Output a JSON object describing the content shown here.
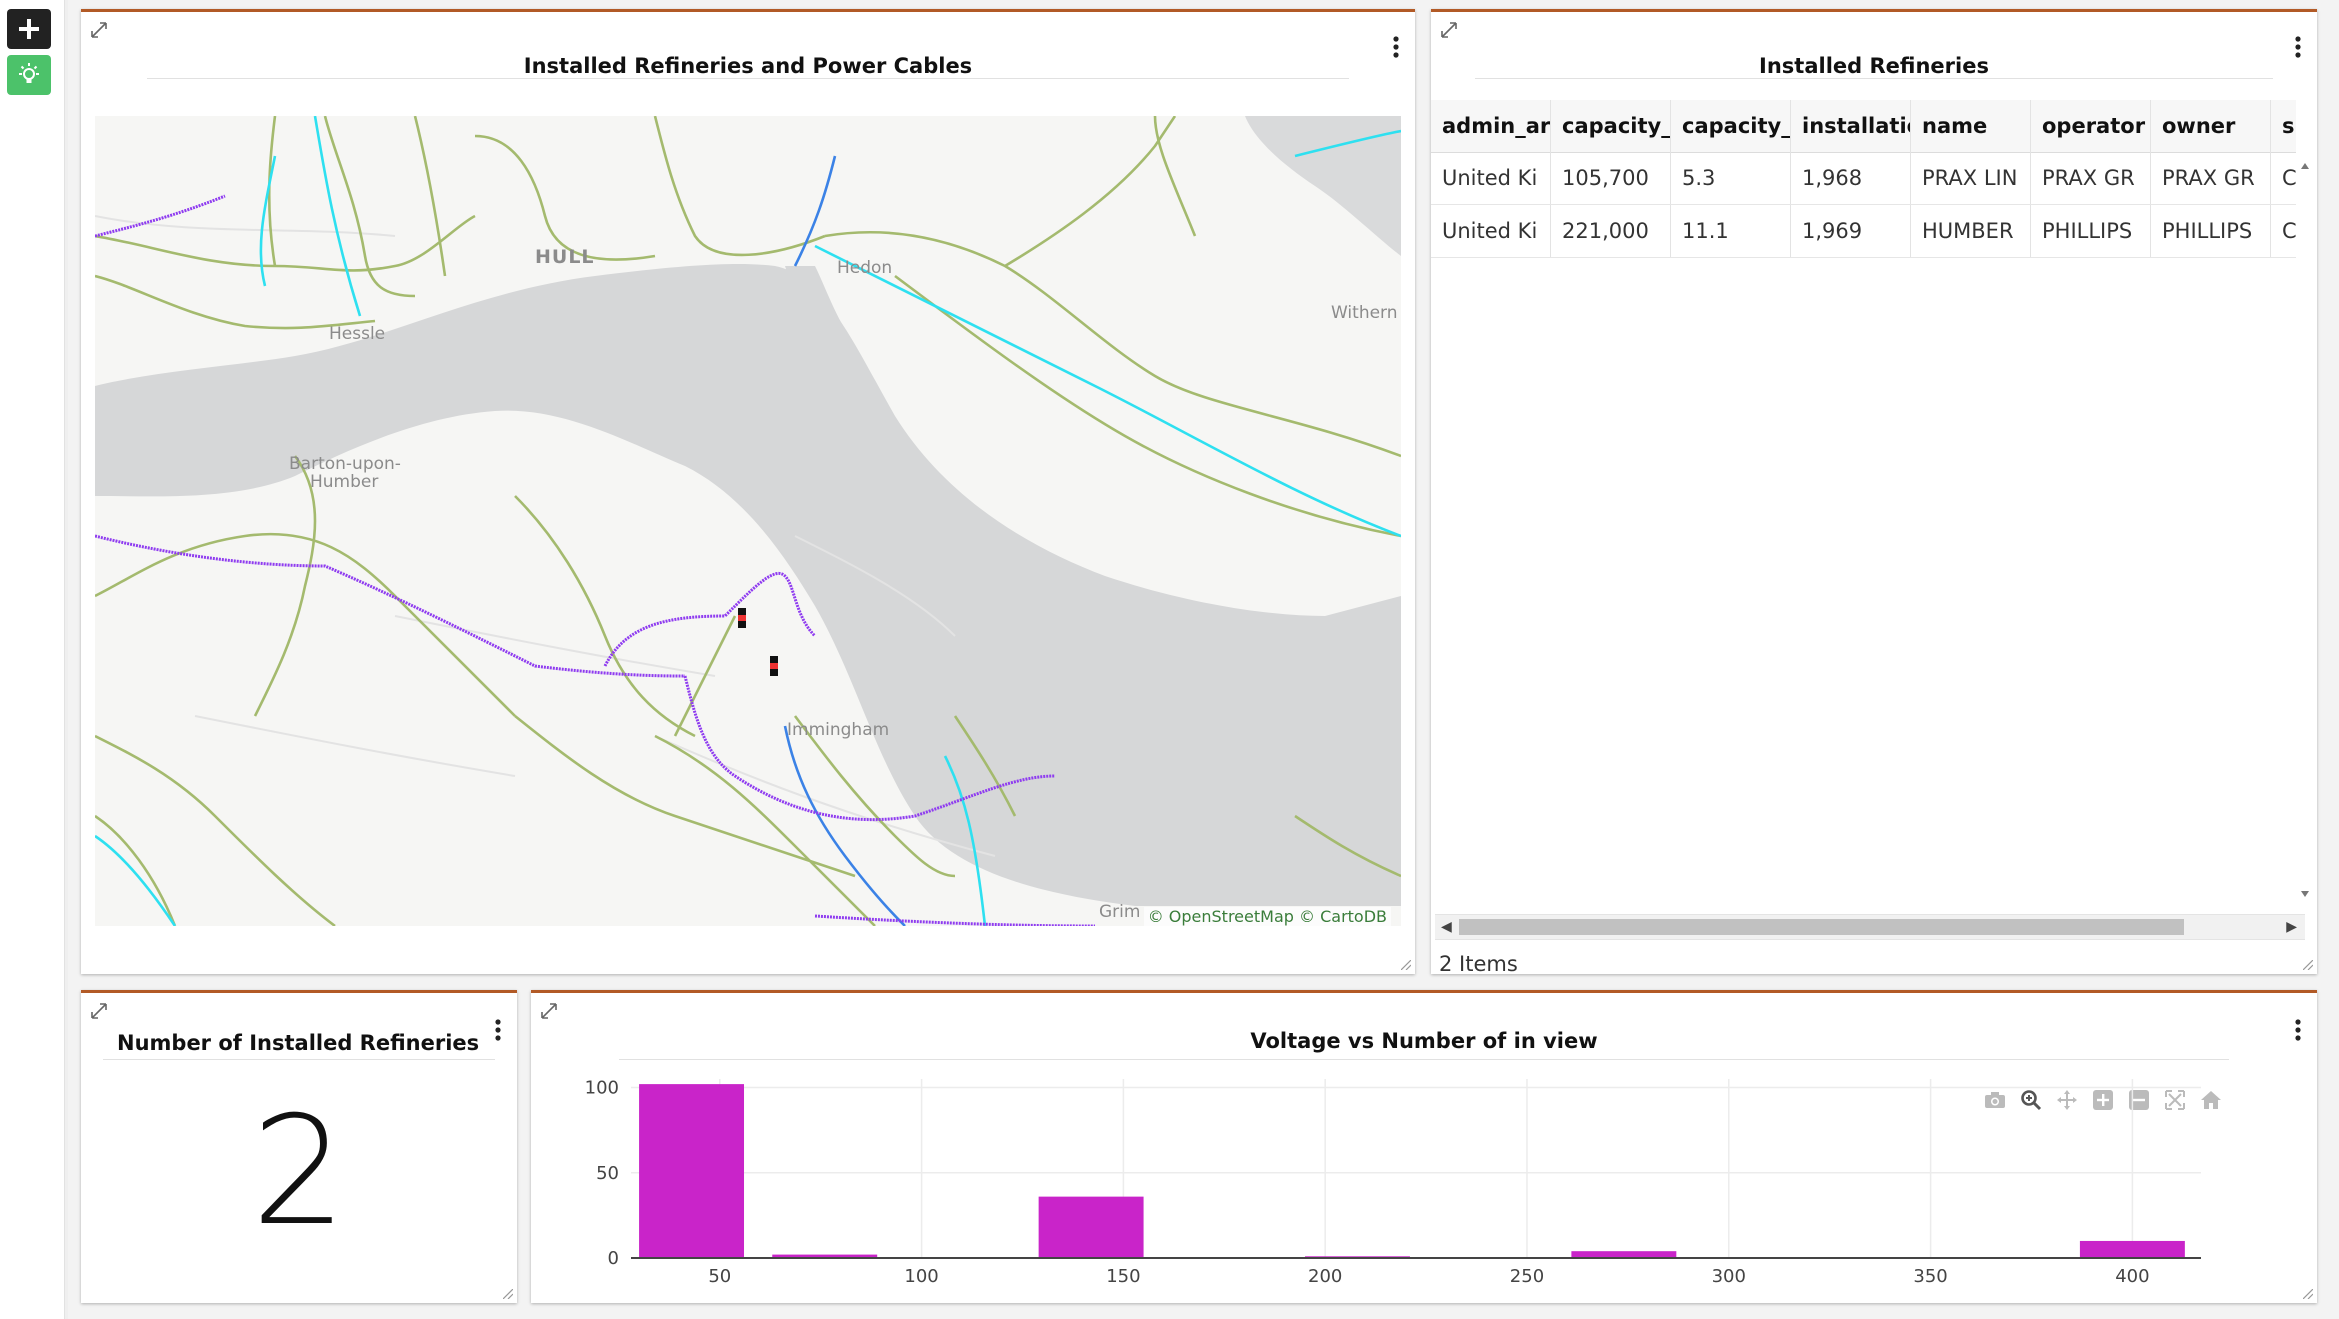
{
  "toolbar": {
    "add_icon": "plus-icon",
    "theme_icon": "lightbulb-icon"
  },
  "map_card": {
    "title": "Installed Refineries and Power Cables",
    "attribution_osm": "© OpenStreetMap",
    "attribution_carto": "© CartoDB",
    "places": {
      "hull": "HULL",
      "hedon": "Hedon",
      "hessle": "Hessle",
      "barton": "Barton-upon-",
      "barton2": "Humber",
      "immingham": "Immingham",
      "withern": "Withern",
      "grim": "Grim"
    }
  },
  "table_card": {
    "title": "Installed Refineries",
    "columns": [
      "admin_are",
      "capacity_l",
      "capacity_r",
      "installatio",
      "name",
      "operator",
      "owner",
      "s"
    ],
    "rows": [
      [
        "United Ki",
        "105,700",
        "5.3",
        "1,968",
        "PRAX LIN",
        "PRAX GR",
        "PRAX GR",
        "C"
      ],
      [
        "United Ki",
        "221,000",
        "11.1",
        "1,969",
        "HUMBER",
        "PHILLIPS",
        "PHILLIPS",
        "C"
      ]
    ],
    "footer": "2 Items"
  },
  "kpi_card": {
    "title": "Number of Installed Refineries in view",
    "value": "2"
  },
  "chart_card": {
    "title": "Voltage vs Number of in view"
  },
  "chart_data": {
    "type": "bar",
    "title": "Voltage vs Number of in view",
    "xlabel": "",
    "ylabel": "",
    "bar_color": "#c924c9",
    "xlim": [
      28,
      417
    ],
    "ylim": [
      0,
      105
    ],
    "x_ticks": [
      50,
      100,
      150,
      200,
      250,
      300,
      350,
      400
    ],
    "y_ticks": [
      0,
      50,
      100
    ],
    "bins": [
      {
        "x0": 30,
        "x1": 56,
        "value": 102
      },
      {
        "x0": 63,
        "x1": 89,
        "value": 2
      },
      {
        "x0": 129,
        "x1": 155,
        "value": 36
      },
      {
        "x0": 195,
        "x1": 221,
        "value": 1
      },
      {
        "x0": 261,
        "x1": 287,
        "value": 4
      },
      {
        "x0": 387,
        "x1": 413,
        "value": 10
      }
    ],
    "grid": true,
    "legend": "none"
  }
}
